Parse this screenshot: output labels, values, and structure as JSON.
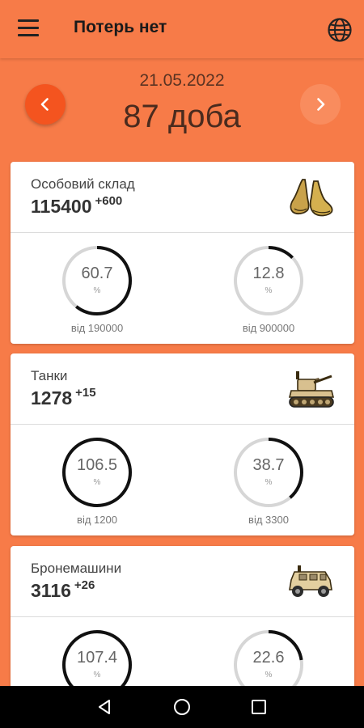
{
  "app": {
    "title": "Потерь нет",
    "date": "21.05.2022",
    "day": "87 доба"
  },
  "icons": {
    "menu": "hamburger-menu-icon",
    "language": "globe-icon",
    "prev": "chevron-left-icon",
    "next": "chevron-right-icon"
  },
  "colors": {
    "background": "#f77b48",
    "prev_button": "#f4541f",
    "next_button": "#f98c5e",
    "ring_filled": "#111111",
    "ring_track": "#d6d6d6"
  },
  "cards": [
    {
      "label": "Особовий склад",
      "value": "115400",
      "delta": "+600",
      "icon": "boots-icon",
      "gauges": [
        {
          "value": "60.7",
          "unit": "%",
          "of": "від 190000",
          "fraction": 0.607
        },
        {
          "value": "12.8",
          "unit": "%",
          "of": "від 900000",
          "fraction": 0.128
        }
      ]
    },
    {
      "label": "Танки",
      "value": "1278",
      "delta": "+15",
      "icon": "tank-icon",
      "gauges": [
        {
          "value": "106.5",
          "unit": "%",
          "of": "від 1200",
          "fraction": 1.0
        },
        {
          "value": "38.7",
          "unit": "%",
          "of": "від 3300",
          "fraction": 0.387
        }
      ]
    },
    {
      "label": "Бронемашини",
      "value": "3116",
      "delta": "+26",
      "icon": "armored-vehicle-icon",
      "gauges": [
        {
          "value": "107.4",
          "unit": "%",
          "of": "",
          "fraction": 1.0
        },
        {
          "value": "22.6",
          "unit": "%",
          "of": "",
          "fraction": 0.226
        }
      ]
    }
  ],
  "system_nav": {
    "back": "back-triangle-icon",
    "home": "home-circle-icon",
    "recents": "recents-square-icon"
  }
}
